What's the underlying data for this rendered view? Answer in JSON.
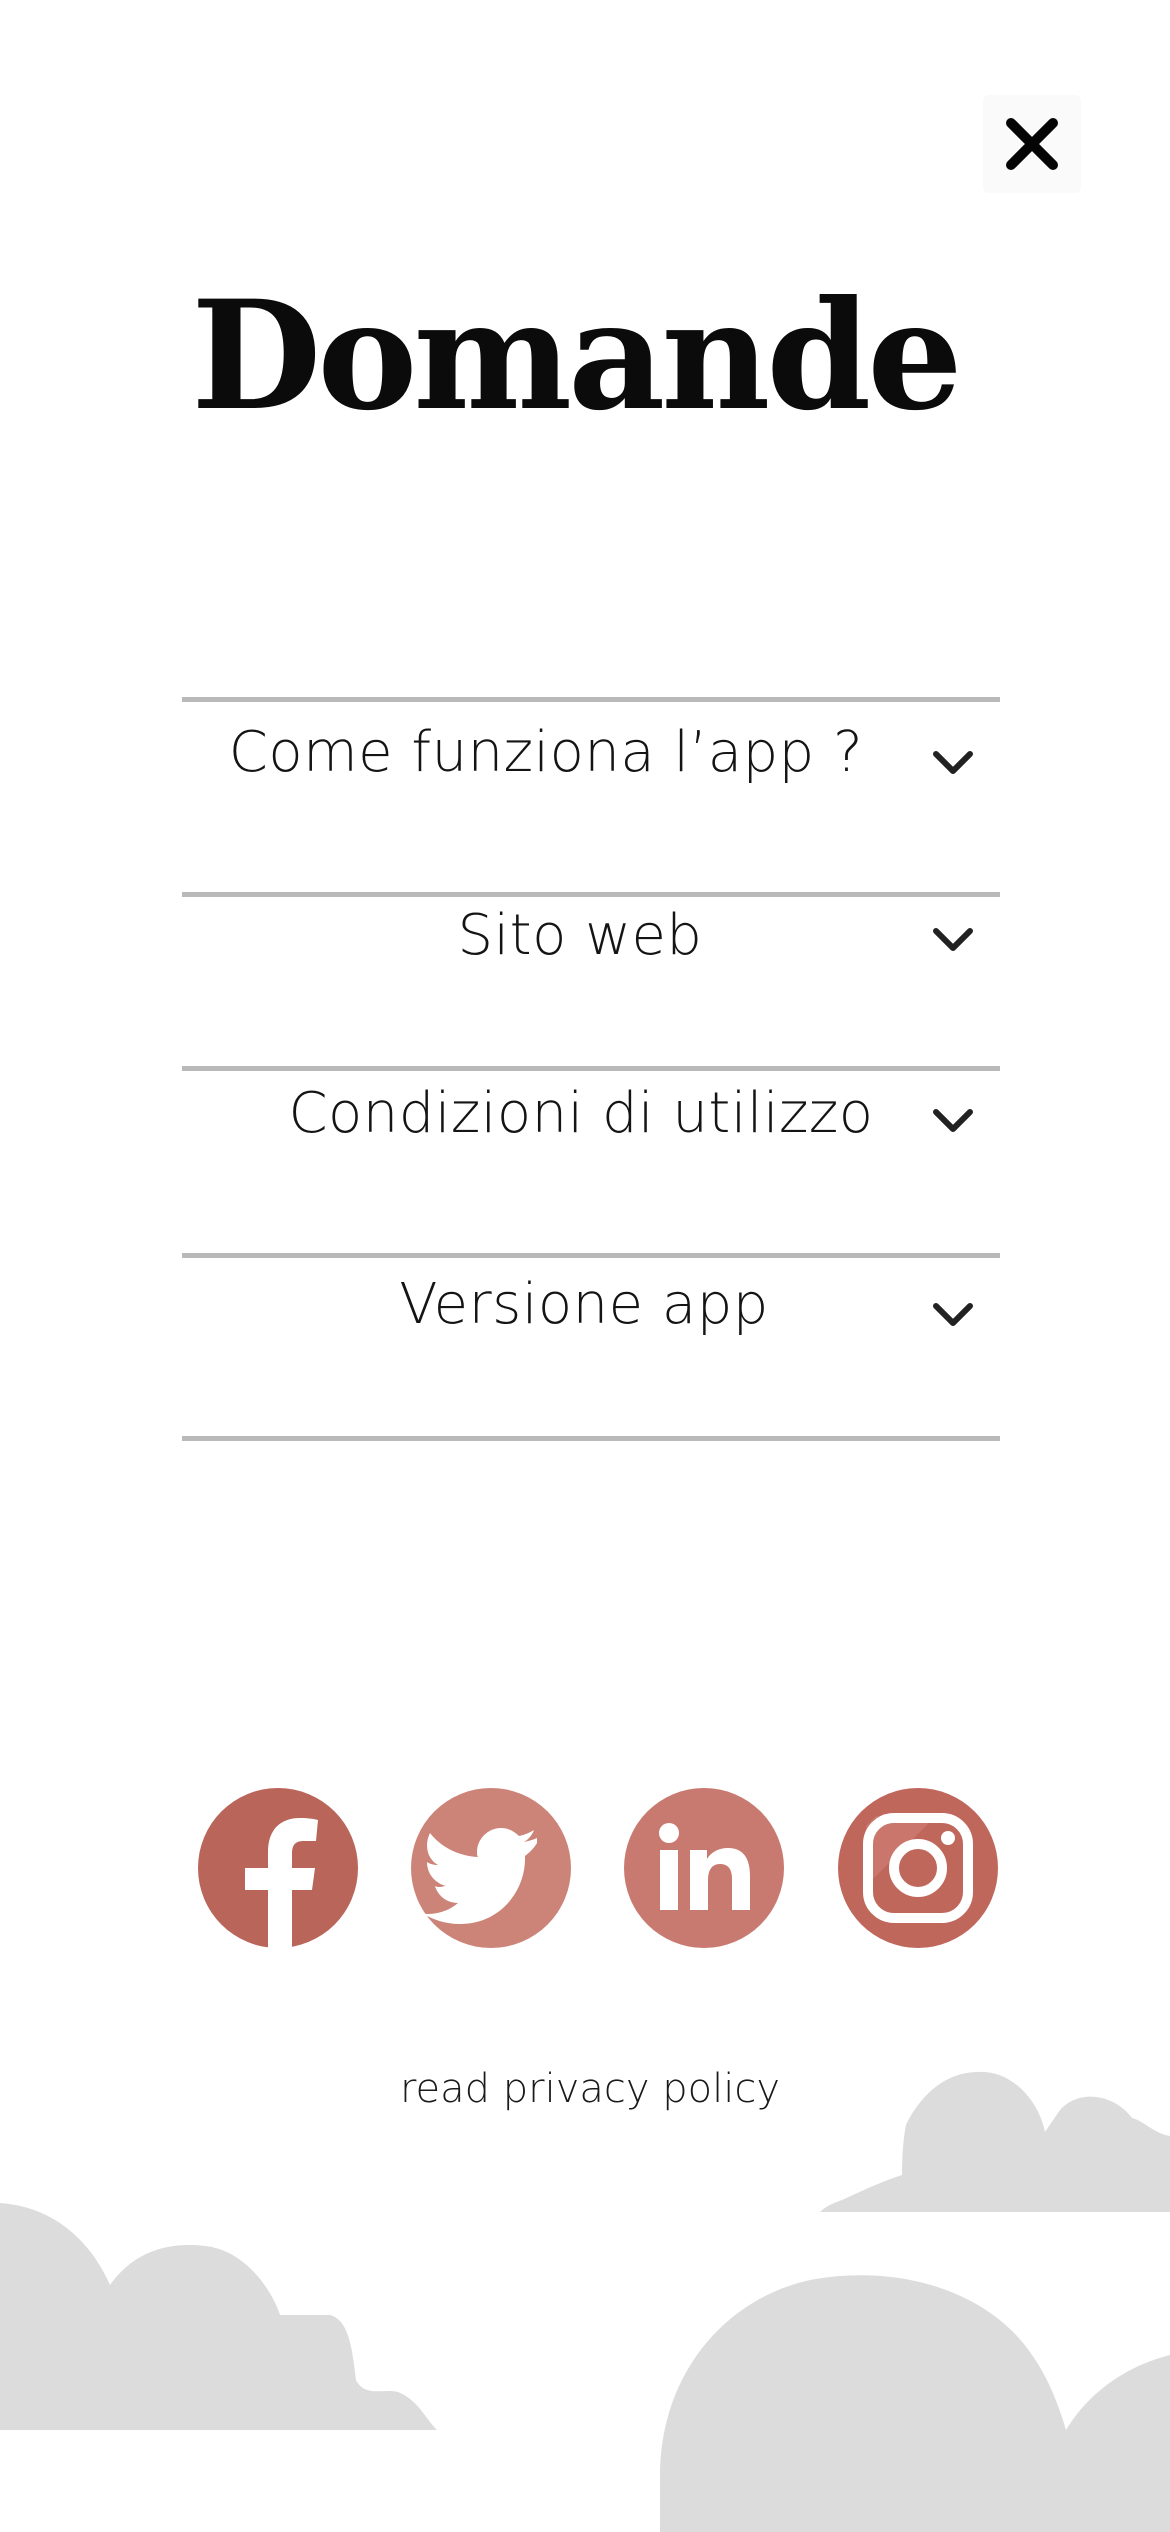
{
  "header": {
    "title": "Domande",
    "close_icon": "close-icon"
  },
  "faq": {
    "items": [
      {
        "label": "Come funziona l’app ?",
        "icon": "chevron-down-icon",
        "expanded": false
      },
      {
        "label": "Sito web",
        "icon": "chevron-down-icon",
        "expanded": false
      },
      {
        "label": "Condizioni di utilizzo",
        "icon": "chevron-down-icon",
        "expanded": false
      },
      {
        "label": "Versione app",
        "icon": "chevron-down-icon",
        "expanded": false
      }
    ]
  },
  "social": {
    "links": [
      {
        "network": "facebook",
        "icon": "facebook-icon",
        "color": "#b9655a"
      },
      {
        "network": "twitter",
        "icon": "twitter-icon",
        "color": "#cc8478"
      },
      {
        "network": "linkedin",
        "icon": "linkedin-icon",
        "color": "#c97a70"
      },
      {
        "network": "instagram",
        "icon": "instagram-icon",
        "color": "#c0675c"
      }
    ]
  },
  "footer": {
    "privacy_link": "read privacy policy"
  },
  "colors": {
    "background": "#ffffff",
    "divider": "#b9b9b9",
    "cloud": "#dcdcdc",
    "text": "#141414"
  }
}
